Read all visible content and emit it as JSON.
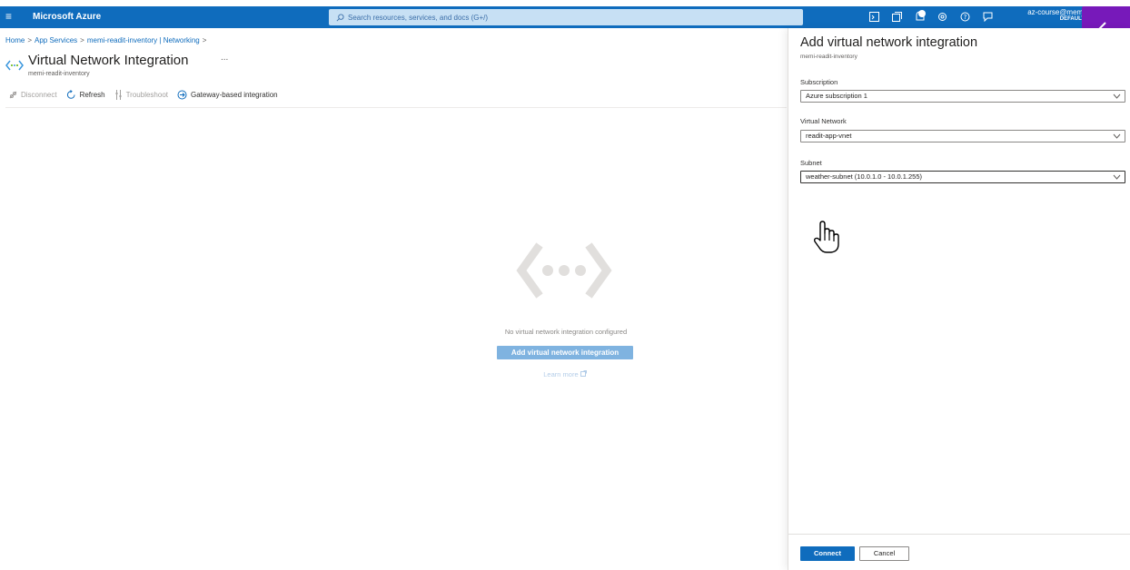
{
  "topbar": {
    "brand": "Microsoft Azure",
    "search_placeholder": "Search resources, services, and docs (G+/)",
    "account_name": "az-course@memi",
    "account_directory": "DEFAULT",
    "icons": [
      "cloud-shell-icon",
      "directory-filter-icon",
      "notifications-icon",
      "settings-icon",
      "help-icon",
      "feedback-icon"
    ],
    "color": "#0f6cbd"
  },
  "breadcrumb": {
    "items": [
      "Home",
      "App Services",
      "memi-readit-inventory | Networking"
    ],
    "separator": ">"
  },
  "page": {
    "title": "Virtual Network Integration",
    "more": "...",
    "subtitle": "memi-readit-inventory"
  },
  "commands": {
    "disconnect": "Disconnect",
    "refresh": "Refresh",
    "troubleshoot": "Troubleshoot",
    "gateway": "Gateway-based integration"
  },
  "empty_state": {
    "message": "No virtual network integration configured",
    "button": "Add virtual network integration",
    "learn_more": "Learn more"
  },
  "panel": {
    "title": "Add virtual network integration",
    "subtitle": "memi-readit-inventory",
    "subscription_label": "Subscription",
    "subscription_value": "Azure subscription 1",
    "vnet_label": "Virtual Network",
    "vnet_value": "readit-app-vnet",
    "subnet_label": "Subnet",
    "subnet_value": "weather-subnet (10.0.1.0 - 10.0.1.255)",
    "connect": "Connect",
    "cancel": "Cancel",
    "back_color": "#7719ba"
  }
}
